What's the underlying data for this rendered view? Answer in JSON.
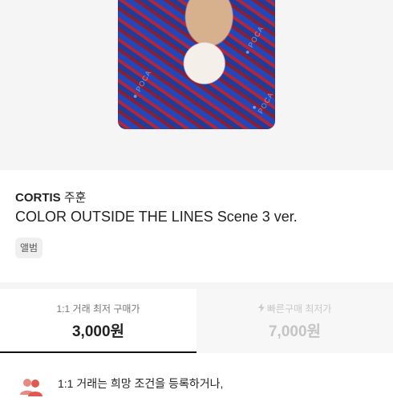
{
  "product": {
    "artist_group": "CORTIS",
    "artist_member": "주훈",
    "title": "COLOR OUTSIDE THE LINES Scene 3 ver.",
    "tag": "앨범"
  },
  "tabs": [
    {
      "label": "1:1 거래 최저 구매가",
      "price": "3,000원",
      "selected": true
    },
    {
      "label": "빠른구매 최저가",
      "price": "7,000원",
      "selected": false,
      "icon": "lightning-icon"
    }
  ],
  "notice": {
    "text": "1:1 거래는 희망 조건을 등록하거나,",
    "icon": "users-icon"
  },
  "colors": {
    "accent": "#111111",
    "muted": "#c4c4c4",
    "icon_red": "#e0584f"
  }
}
